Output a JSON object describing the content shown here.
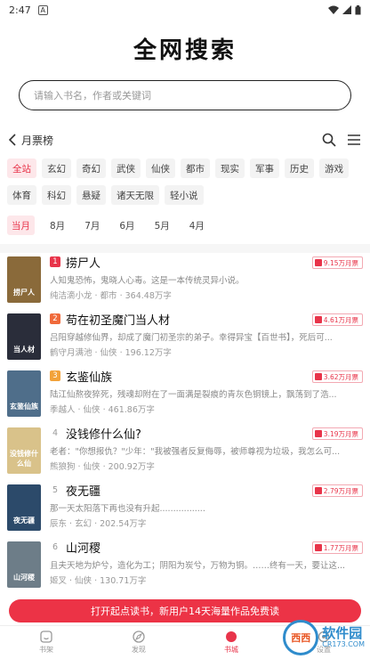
{
  "status_bar": {
    "time": "2:47"
  },
  "brand": {
    "title": "全网搜索"
  },
  "search": {
    "placeholder": "请输入书名，作者或关键词"
  },
  "rank_header": {
    "title": "月票榜"
  },
  "categories": [
    "全站",
    "玄幻",
    "奇幻",
    "武侠",
    "仙侠",
    "都市",
    "现实",
    "军事",
    "历史",
    "游戏",
    "体育",
    "科幻",
    "悬疑",
    "诸天无限",
    "轻小说"
  ],
  "months": [
    "当月",
    "8月",
    "7月",
    "6月",
    "5月",
    "4月"
  ],
  "books": [
    {
      "rank": "1",
      "title": "捞尸人",
      "desc": "人知鬼恐怖，鬼晓人心毒。这是一本传统灵异小说。",
      "meta": "纯洁滴小龙 · 都市 · 364.48万字",
      "tickets": "9.15万月票",
      "cover_text": "捞尸人",
      "cover_color": "#8a6a3a"
    },
    {
      "rank": "2",
      "title": "苟在初圣魔门当人材",
      "desc": "吕阳穿越修仙界，却成了魔门初圣宗的弟子。幸得异宝【百世书】，死后可...",
      "meta": "鹤守月满池 · 仙侠 · 196.12万字",
      "tickets": "4.61万月票",
      "cover_text": "当人材",
      "cover_color": "#2a2d3a"
    },
    {
      "rank": "3",
      "title": "玄鉴仙族",
      "desc": "陆江仙熬夜猝死，残魂却附在了一面满是裂痕的青灰色铜镜上，飘荡到了浩...",
      "meta": "季越人 · 仙侠 · 461.86万字",
      "tickets": "3.62万月票",
      "cover_text": "玄鉴仙族",
      "cover_color": "#4f6e8a"
    },
    {
      "rank": "4",
      "title": "没钱修什么仙?",
      "desc": "老者：\"你想报仇？\"少年：\"我被强者反复侮辱，被师尊视为垃圾，我怎么可...",
      "meta": "熊狼狗 · 仙侠 · 200.92万字",
      "tickets": "3.19万月票",
      "cover_text": "没钱修什么仙",
      "cover_color": "#d9c28a"
    },
    {
      "rank": "5",
      "title": "夜无疆",
      "desc": "那一天太阳落下再也没有升起.................",
      "meta": "辰东 · 玄幻 · 202.54万字",
      "tickets": "2.79万月票",
      "cover_text": "夜无疆",
      "cover_color": "#2c4a6a"
    },
    {
      "rank": "6",
      "title": "山河稷",
      "desc": "且夫天地为炉兮，造化为工；阴阳为炭兮，万物为铜。……终有一天，要让这...",
      "meta": "姬叉 · 仙侠 · 130.71万字",
      "tickets": "1.77万月票",
      "cover_text": "山河稷",
      "cover_color": "#6d7d88"
    }
  ],
  "promo": {
    "text": "打开起点读书，新用户14天海量作品免费读"
  },
  "tabs": [
    "书架",
    "发现",
    "书城",
    "设置"
  ],
  "watermark": {
    "logo": "西西",
    "main": "软件园",
    "sub": "CR173.COM"
  },
  "colors": {
    "accent": "#e8344a",
    "promo": "#ec3346"
  }
}
